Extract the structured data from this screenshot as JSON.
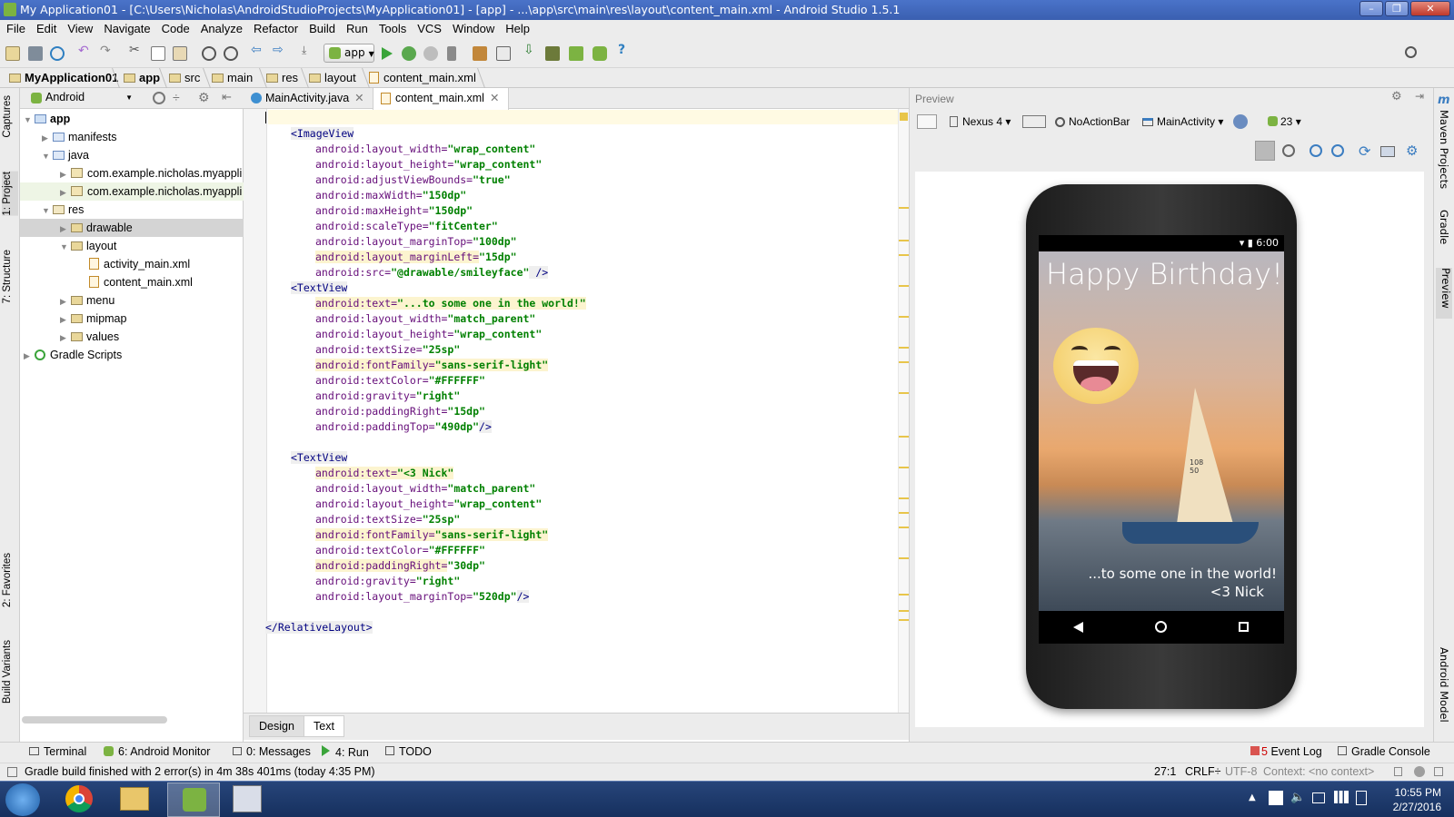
{
  "window": {
    "title": "My Application01 - [C:\\Users\\Nicholas\\AndroidStudioProjects\\MyApplication01] - [app] - ...\\app\\src\\main\\res\\layout\\content_main.xml - Android Studio 1.5.1"
  },
  "menu": [
    "File",
    "Edit",
    "View",
    "Navigate",
    "Code",
    "Analyze",
    "Refactor",
    "Build",
    "Run",
    "Tools",
    "VCS",
    "Window",
    "Help"
  ],
  "toolbar": {
    "run_config": "app"
  },
  "breadcrumb": [
    "MyApplication01",
    "app",
    "src",
    "main",
    "res",
    "layout",
    "content_main.xml"
  ],
  "left_tabs": {
    "captures": "Captures",
    "project": "1: Project",
    "structure": "7: Structure",
    "favorites": "2: Favorites",
    "build_variants": "Build Variants"
  },
  "project_panel": {
    "view_mode": "Android"
  },
  "tree": {
    "app": "app",
    "manifests": "manifests",
    "java": "java",
    "pkg1": "com.example.nicholas.myappli",
    "pkg2": "com.example.nicholas.myappli",
    "res": "res",
    "drawable": "drawable",
    "layout": "layout",
    "activity_main": "activity_main.xml",
    "content_main": "content_main.xml",
    "menu": "menu",
    "mipmap": "mipmap",
    "values": "values",
    "gradle": "Gradle Scripts"
  },
  "editor": {
    "tabs": [
      "MainActivity.java",
      "content_main.xml"
    ],
    "bottom_tabs": [
      "Design",
      "Text"
    ],
    "lines": {
      "l1": "<ImageView",
      "l2a": "android:layout_width=",
      "l2b": "\"wrap_content\"",
      "l3a": "android:layout_height=",
      "l3b": "\"wrap_content\"",
      "l4a": "android:adjustViewBounds=",
      "l4b": "\"true\"",
      "l5a": "android:maxWidth=",
      "l5b": "\"150dp\"",
      "l6a": "android:maxHeight=",
      "l6b": "\"150dp\"",
      "l7a": "android:scaleType=",
      "l7b": "\"fitCenter\"",
      "l8a": "android:layout_marginTop=",
      "l8b": "\"100dp\"",
      "l9a": "android:layout_marginLeft=",
      "l9b": "\"15dp\"",
      "l10a": "android:src=",
      "l10b": "\"@drawable/smileyface\"",
      "l10c": " />",
      "l11": "<TextView",
      "l12a": "android:text=",
      "l12b": "\"...to some one in the world!\"",
      "l13a": "android:layout_width=",
      "l13b": "\"match_parent\"",
      "l14a": "android:layout_height=",
      "l14b": "\"wrap_content\"",
      "l15a": "android:textSize=",
      "l15b": "\"25sp\"",
      "l16a": "android:fontFamily=",
      "l16b": "\"sans-serif-light\"",
      "l17a": "android:textColor=",
      "l17b": "\"#FFFFFF\"",
      "l18a": "android:gravity=",
      "l18b": "\"right\"",
      "l19a": "android:paddingRight=",
      "l19b": "\"15dp\"",
      "l20a": "android:paddingTop=",
      "l20b": "\"490dp\"",
      "l20c": "/>",
      "l21": "<TextView",
      "l22a": "android:text=",
      "l22b": "\"<3 Nick\"",
      "l23a": "android:layout_width=",
      "l23b": "\"match_parent\"",
      "l24a": "android:layout_height=",
      "l24b": "\"wrap_content\"",
      "l25a": "android:textSize=",
      "l25b": "\"25sp\"",
      "l26a": "android:fontFamily=",
      "l26b": "\"sans-serif-light\"",
      "l27a": "android:textColor=",
      "l27b": "\"#FFFFFF\"",
      "l28a": "android:paddingRight=",
      "l28b": "\"30dp\"",
      "l29a": "android:gravity=",
      "l29b": "\"right\"",
      "l30a": "android:layout_marginTop=",
      "l30b": "\"520dp\"",
      "l30c": "/>",
      "l31": "</RelativeLayout>"
    }
  },
  "preview": {
    "title": "Preview",
    "device": "Nexus 4",
    "theme": "NoActionBar",
    "activity": "MainActivity",
    "api": "23",
    "phone": {
      "clock": "6:00",
      "headline": "Happy Birthday!",
      "line1": "...to some one in the world!",
      "line2": "<3 Nick",
      "sail_number_1": "108",
      "sail_number_2": "50"
    }
  },
  "right_tabs": {
    "maven": "Maven Projects",
    "gradle": "Gradle",
    "preview": "Preview",
    "android_model": "Android Model"
  },
  "bottom_tools": {
    "terminal": "Terminal",
    "monitor": "6: Android Monitor",
    "messages": "0: Messages",
    "run": "4: Run",
    "todo": "TODO",
    "event_log": "Event Log",
    "event_count": "5",
    "gradle_console": "Gradle Console"
  },
  "status": {
    "message": "Gradle build finished with 2 error(s) in 4m 38s 401ms (today 4:35 PM)",
    "position": "27:1",
    "line_sep": "CRLF÷",
    "encoding": "UTF-8",
    "context": "Context: <no context>"
  },
  "taskbar": {
    "time": "10:55 PM",
    "date": "2/27/2016"
  },
  "colors": {
    "title_bar": "#3a5fb0",
    "xml_tag": "#000080",
    "xml_attr": "#660e7a",
    "xml_value": "#008000",
    "highlight": "#fcf4cf"
  }
}
